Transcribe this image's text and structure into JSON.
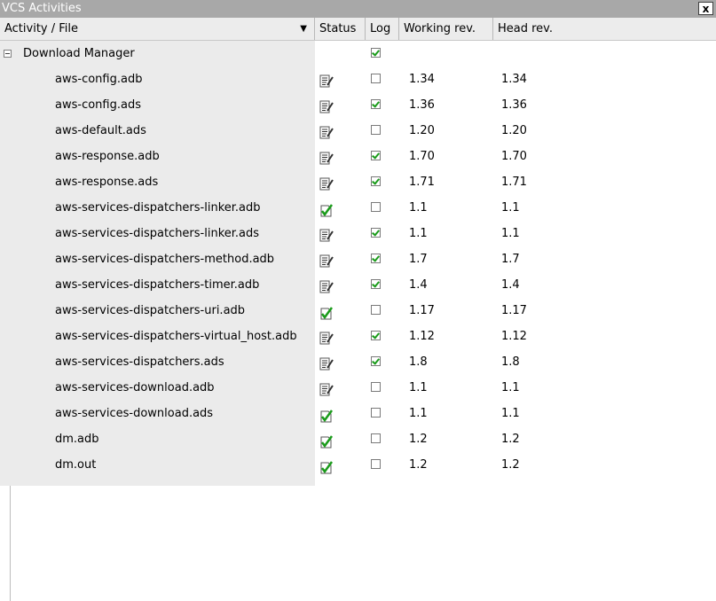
{
  "panel": {
    "title": "VCS Activities",
    "close_label": "x"
  },
  "columns": {
    "activity": "Activity / File",
    "status": "Status",
    "log": "Log",
    "working_rev": "Working rev.",
    "head_rev": "Head rev."
  },
  "group": {
    "label": "Download Manager",
    "log_checked": true,
    "expanded": true
  },
  "files": [
    {
      "name": "aws-config.adb",
      "status": "modified",
      "log": false,
      "working_rev": "1.34",
      "head_rev": "1.34"
    },
    {
      "name": "aws-config.ads",
      "status": "modified",
      "log": true,
      "working_rev": "1.36",
      "head_rev": "1.36"
    },
    {
      "name": "aws-default.ads",
      "status": "modified",
      "log": false,
      "working_rev": "1.20",
      "head_rev": "1.20"
    },
    {
      "name": "aws-response.adb",
      "status": "modified",
      "log": true,
      "working_rev": "1.70",
      "head_rev": "1.70"
    },
    {
      "name": "aws-response.ads",
      "status": "modified",
      "log": true,
      "working_rev": "1.71",
      "head_rev": "1.71"
    },
    {
      "name": "aws-services-dispatchers-linker.adb",
      "status": "up-to-date",
      "log": false,
      "working_rev": "1.1",
      "head_rev": "1.1"
    },
    {
      "name": "aws-services-dispatchers-linker.ads",
      "status": "modified",
      "log": true,
      "working_rev": "1.1",
      "head_rev": "1.1"
    },
    {
      "name": "aws-services-dispatchers-method.adb",
      "status": "modified",
      "log": true,
      "working_rev": "1.7",
      "head_rev": "1.7"
    },
    {
      "name": "aws-services-dispatchers-timer.adb",
      "status": "modified",
      "log": true,
      "working_rev": "1.4",
      "head_rev": "1.4"
    },
    {
      "name": "aws-services-dispatchers-uri.adb",
      "status": "up-to-date",
      "log": false,
      "working_rev": "1.17",
      "head_rev": "1.17"
    },
    {
      "name": "aws-services-dispatchers-virtual_host.adb",
      "status": "modified",
      "log": true,
      "working_rev": "1.12",
      "head_rev": "1.12"
    },
    {
      "name": "aws-services-dispatchers.ads",
      "status": "modified",
      "log": true,
      "working_rev": "1.8",
      "head_rev": "1.8"
    },
    {
      "name": "aws-services-download.adb",
      "status": "modified",
      "log": false,
      "working_rev": "1.1",
      "head_rev": "1.1"
    },
    {
      "name": "aws-services-download.ads",
      "status": "up-to-date",
      "log": false,
      "working_rev": "1.1",
      "head_rev": "1.1"
    },
    {
      "name": "dm.adb",
      "status": "up-to-date",
      "log": false,
      "working_rev": "1.2",
      "head_rev": "1.2"
    },
    {
      "name": "dm.out",
      "status": "up-to-date",
      "log": false,
      "working_rev": "1.2",
      "head_rev": "1.2"
    }
  ],
  "colors": {
    "check": "#1a9b1a",
    "titlebar": "#a8a8a8"
  }
}
